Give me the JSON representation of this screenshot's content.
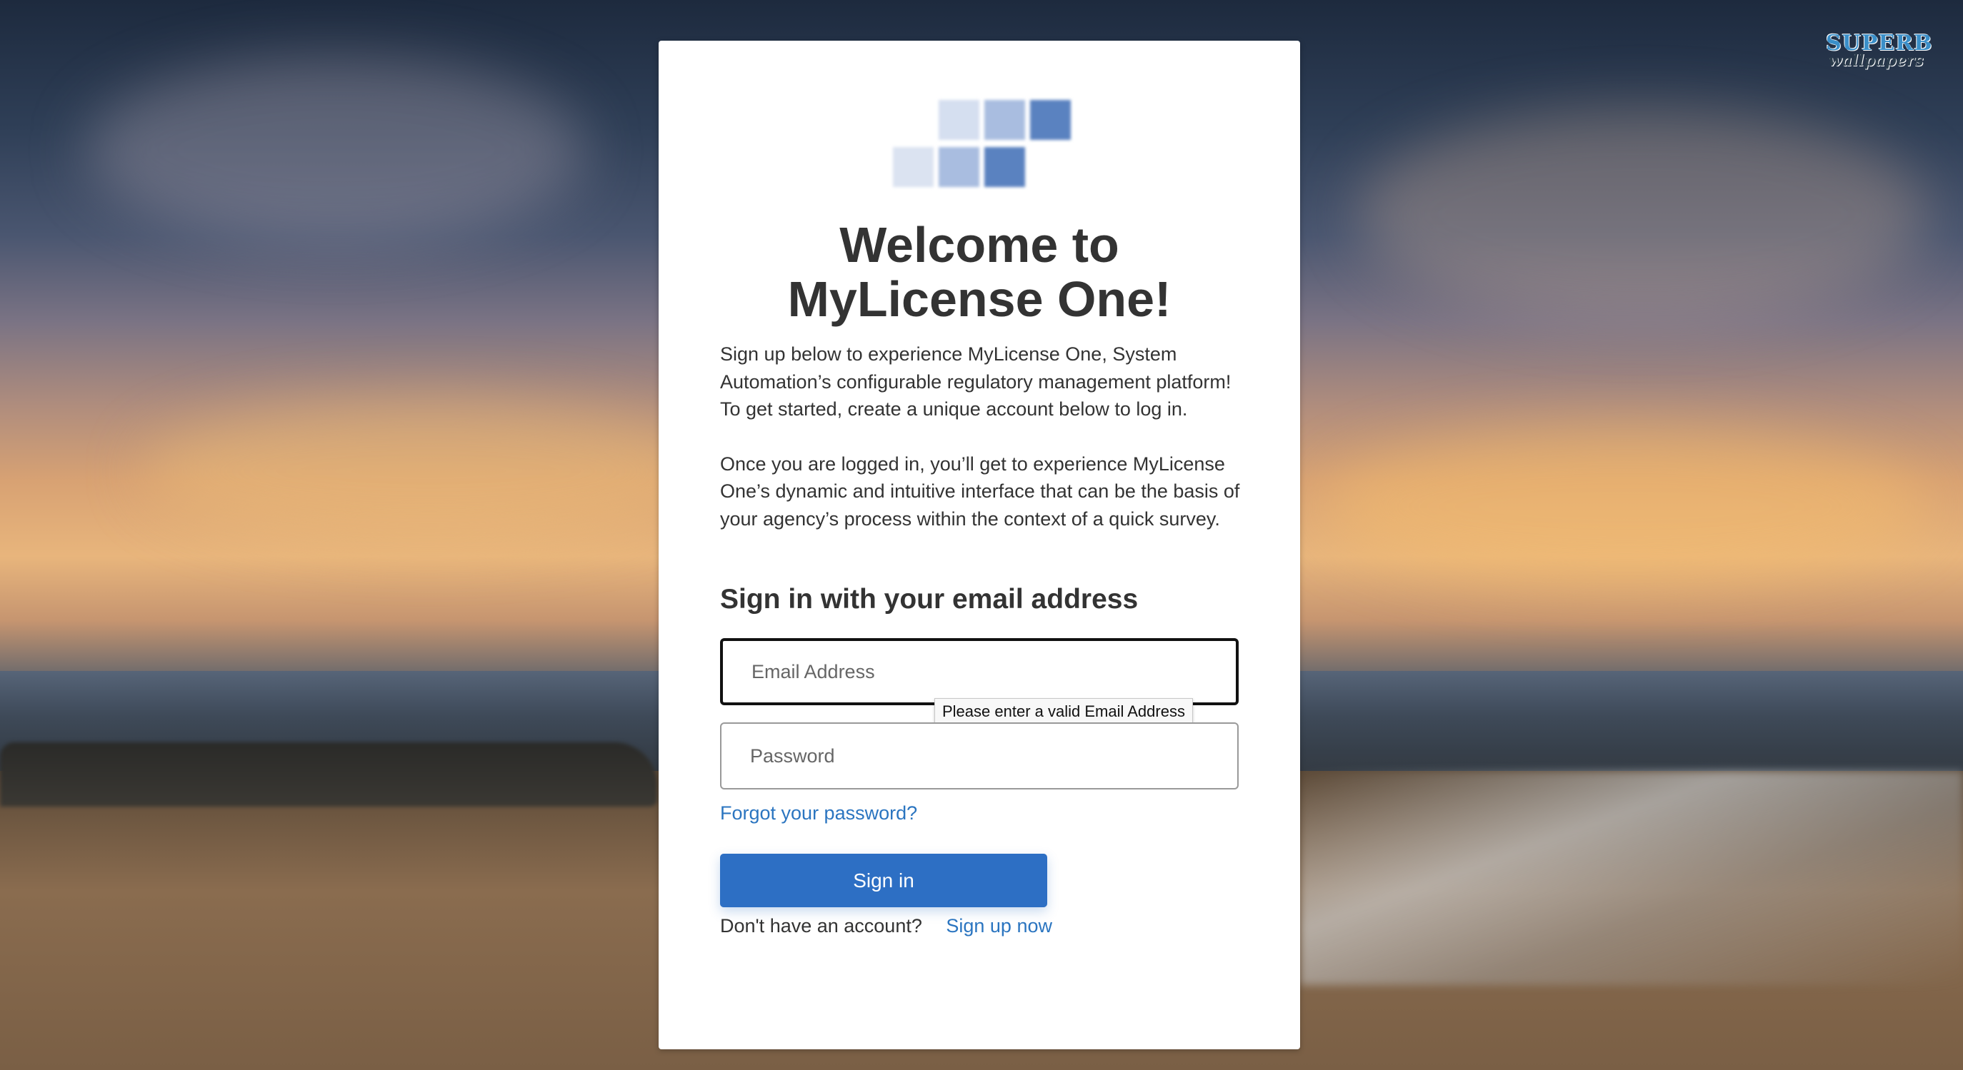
{
  "watermark": {
    "line1": "SUPERB",
    "line2": "wallpapers"
  },
  "logo": {
    "icon": "stacked-squares-logo-icon",
    "colors": [
      "#d5dff0",
      "#a9bde0",
      "#5a82c0"
    ]
  },
  "card": {
    "title": "Welcome to MyLicense One!",
    "intro_paragraphs": [
      "Sign up below to experience MyLicense One, System Automation’s configurable regulatory management platform! To get started, create a unique account below to log in.",
      "Once you are logged in, you’ll get to experience MyLicense One’s dynamic and intuitive interface that can be the basis of your agency’s process within the context of a quick survey."
    ],
    "section_heading": "Sign in with your email address",
    "email": {
      "placeholder": "Email Address",
      "value": ""
    },
    "validation_tooltip": "Please enter a valid Email Address",
    "password": {
      "placeholder": "Password",
      "value": ""
    },
    "forgot_password_link": "Forgot your password?",
    "signin_button": "Sign in",
    "signup_prompt": "Don't have an account?",
    "signup_link": "Sign up now"
  },
  "colors": {
    "primary": "#2d6fc4",
    "link": "#2b75c0",
    "text": "#333333"
  }
}
